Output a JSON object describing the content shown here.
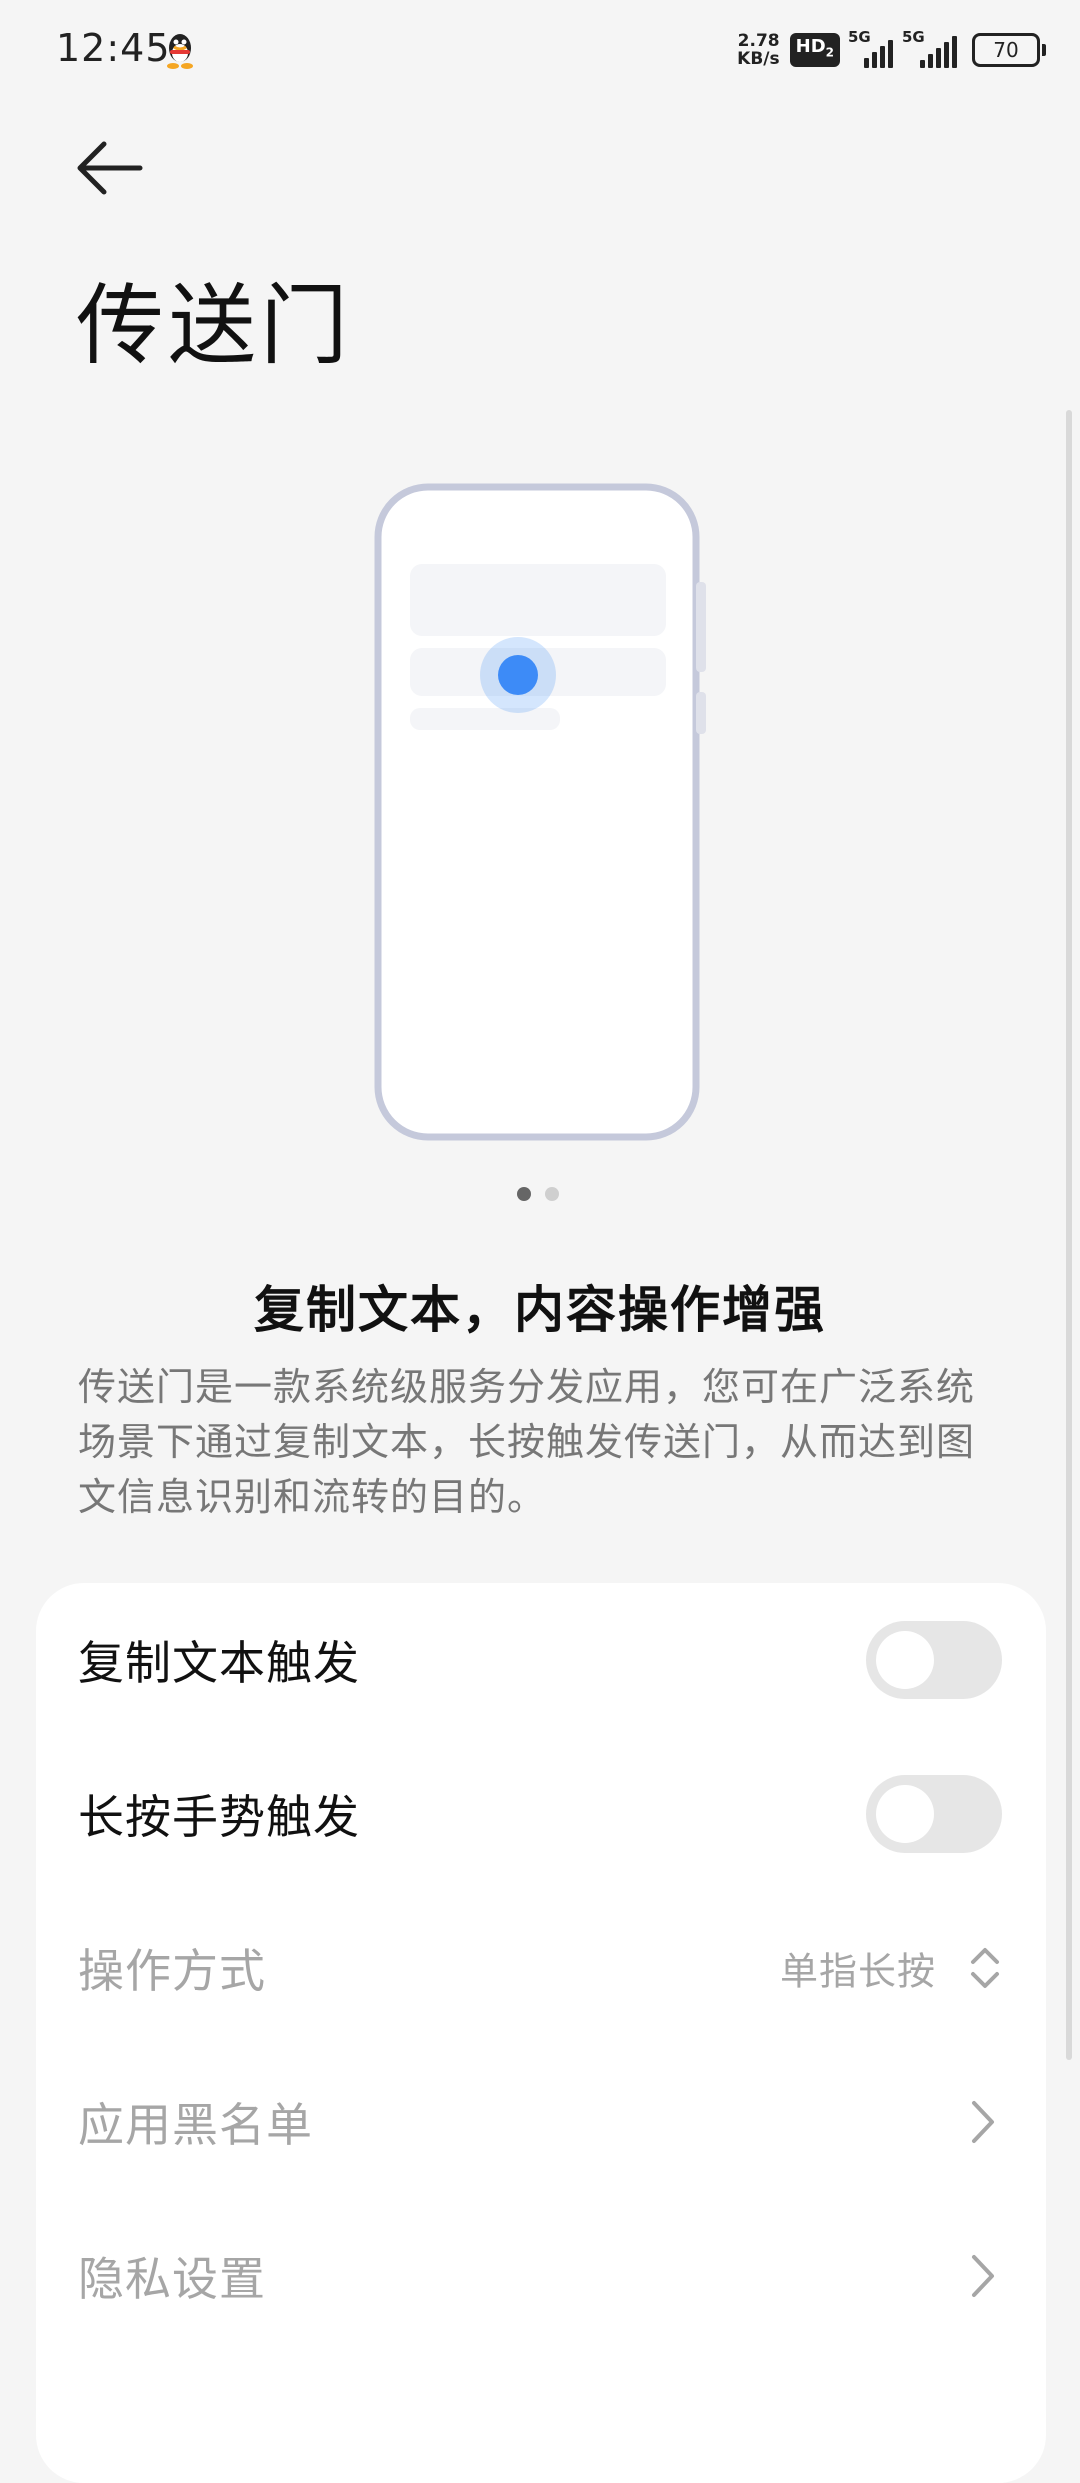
{
  "status_bar": {
    "time": "12:45",
    "net_speed_value": "2.78",
    "net_speed_unit": "KB/s",
    "hd_label": "HD",
    "hd_sub": "2",
    "signal1_label": "5G",
    "signal2_label": "5G",
    "battery_level": "70"
  },
  "header": {
    "title": "传送门"
  },
  "carousel": {
    "page_count": 2,
    "active_page": 1
  },
  "feature": {
    "title": "复制文本，内容操作增强",
    "description": "传送门是一款系统级服务分发应用，您可在广泛系统场景下通过复制文本，长按触发传送门，从而达到图文信息识别和流转的目的。"
  },
  "settings": {
    "copy_text_trigger": {
      "label": "复制文本触发",
      "enabled": false
    },
    "long_press_trigger": {
      "label": "长按手势触发",
      "enabled": false
    },
    "operation_mode": {
      "label": "操作方式",
      "value": "单指长按"
    },
    "app_blacklist": {
      "label": "应用黑名单"
    },
    "privacy_settings": {
      "label": "隐私设置"
    }
  },
  "colors": {
    "accent_blue": "#3d8bf7",
    "phone_outline": "#c5c9db",
    "background": "#f5f5f5"
  }
}
